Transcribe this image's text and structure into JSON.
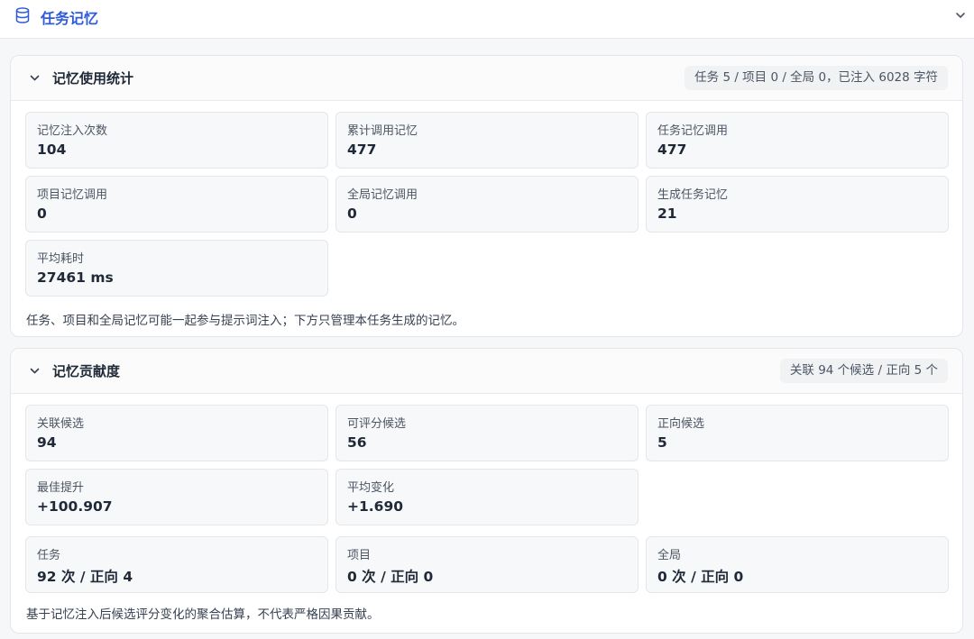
{
  "header": {
    "title": "任务记忆"
  },
  "usage": {
    "title": "记忆使用统计",
    "summary": "任务 5 / 项目 0 / 全局 0，已注入 6028 字符",
    "stats": [
      {
        "label": "记忆注入次数",
        "value": "104"
      },
      {
        "label": "累计调用记忆",
        "value": "477"
      },
      {
        "label": "任务记忆调用",
        "value": "477"
      },
      {
        "label": "项目记忆调用",
        "value": "0"
      },
      {
        "label": "全局记忆调用",
        "value": "0"
      },
      {
        "label": "生成任务记忆",
        "value": "21"
      },
      {
        "label": "平均耗时",
        "value": "27461 ms"
      }
    ],
    "note": "任务、项目和全局记忆可能一起参与提示词注入；下方只管理本任务生成的记忆。"
  },
  "contribution": {
    "title": "记忆贡献度",
    "summary": "关联 94 个候选 / 正向 5 个",
    "stats": [
      {
        "label": "关联候选",
        "value": "94"
      },
      {
        "label": "可评分候选",
        "value": "56"
      },
      {
        "label": "正向候选",
        "value": "5"
      },
      {
        "label": "最佳提升",
        "value": "+100.907"
      },
      {
        "label": "平均变化",
        "value": "+1.690"
      }
    ],
    "scopes": [
      {
        "label": "任务",
        "value": "92 次 / 正向 4"
      },
      {
        "label": "项目",
        "value": "0 次 / 正向 0"
      },
      {
        "label": "全局",
        "value": "0 次 / 正向 0"
      }
    ],
    "note": "基于记忆注入后候选评分变化的聚合估算，不代表严格因果贡献。"
  }
}
